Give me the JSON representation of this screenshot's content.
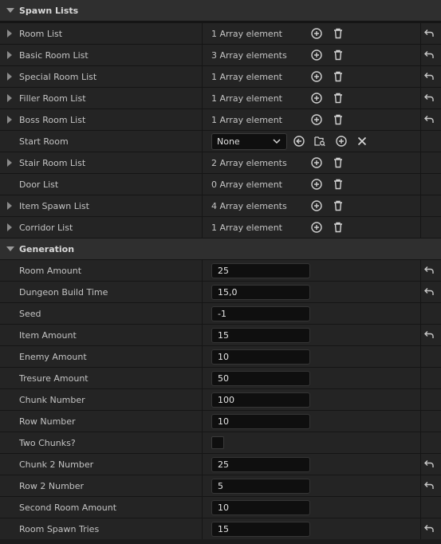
{
  "sections": {
    "spawn_lists": "Spawn Lists",
    "generation": "Generation"
  },
  "spawn_rows": [
    {
      "label": "Room List",
      "value": "1 Array element",
      "reset": true
    },
    {
      "label": "Basic Room List",
      "value": "3 Array elements",
      "reset": true
    },
    {
      "label": "Special Room List",
      "value": "1 Array element",
      "reset": true
    },
    {
      "label": "Filler Room List",
      "value": "1 Array element",
      "reset": true
    },
    {
      "label": "Boss Room List",
      "value": "1 Array element",
      "reset": true
    },
    {
      "label": "Start Room",
      "value": "None"
    },
    {
      "label": "Stair Room List",
      "value": "2 Array elements"
    },
    {
      "label": "Door List",
      "value": "0 Array element"
    },
    {
      "label": "Item Spawn List",
      "value": "4 Array elements"
    },
    {
      "label": "Corridor List",
      "value": "1 Array element"
    }
  ],
  "generation_rows": [
    {
      "label": "Room Amount",
      "value": "25",
      "reset": true
    },
    {
      "label": "Dungeon Build Time",
      "value": "15,0",
      "reset": true
    },
    {
      "label": "Seed",
      "value": "-1"
    },
    {
      "label": "Item Amount",
      "value": "15",
      "reset": true
    },
    {
      "label": "Enemy Amount",
      "value": "10"
    },
    {
      "label": "Tresure Amount",
      "value": "50"
    },
    {
      "label": "Chunk Number",
      "value": "100"
    },
    {
      "label": "Row Number",
      "value": "10"
    },
    {
      "label": "Two Chunks?",
      "checked": false
    },
    {
      "label": "Chunk 2 Number",
      "value": "25",
      "reset": true
    },
    {
      "label": "Row 2 Number",
      "value": "5",
      "reset": true
    },
    {
      "label": "Second Room Amount",
      "value": "10"
    },
    {
      "label": "Room Spawn Tries",
      "value": "15",
      "reset": true
    }
  ],
  "icons": {
    "add": "plus-circle-icon",
    "delete": "trash-icon",
    "reset": "reset-arrow-icon",
    "use_selected": "arrow-left-circle-icon",
    "browse": "folder-search-icon",
    "clear": "close-icon",
    "dropdown": "chevron-down-icon"
  },
  "colors": {
    "background": "#151515",
    "row": "#242424",
    "section": "#2f2f2f",
    "input": "#0f0f0f",
    "text": "#c4c4c4"
  }
}
